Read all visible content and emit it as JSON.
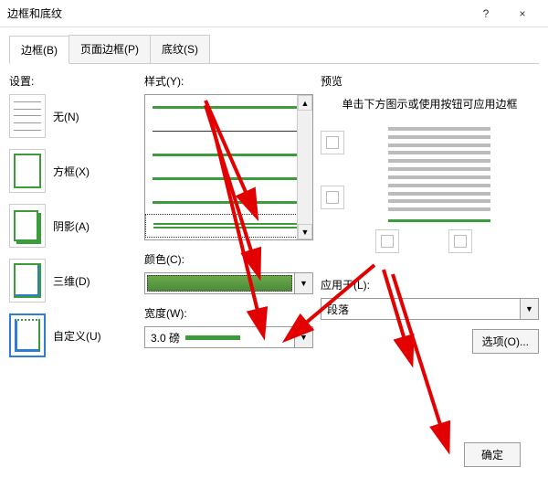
{
  "window": {
    "title": "边框和底纹",
    "help": "?",
    "close": "×"
  },
  "tabs": {
    "border": "边框(B)",
    "page_border": "页面边框(P)",
    "shading": "底纹(S)"
  },
  "settings": {
    "label": "设置:",
    "none": "无(N)",
    "box": "方框(X)",
    "shadow": "阴影(A)",
    "threeD": "三维(D)",
    "custom": "自定义(U)"
  },
  "style": {
    "label": "样式(Y):"
  },
  "color": {
    "label": "颜色(C):"
  },
  "width": {
    "label": "宽度(W):",
    "value": "3.0 磅"
  },
  "preview": {
    "label": "预览",
    "hint": "单击下方图示或使用按钮可应用边框"
  },
  "apply": {
    "label": "应用于(L):",
    "value": "段落"
  },
  "buttons": {
    "options": "选项(O)...",
    "ok": "确定"
  }
}
